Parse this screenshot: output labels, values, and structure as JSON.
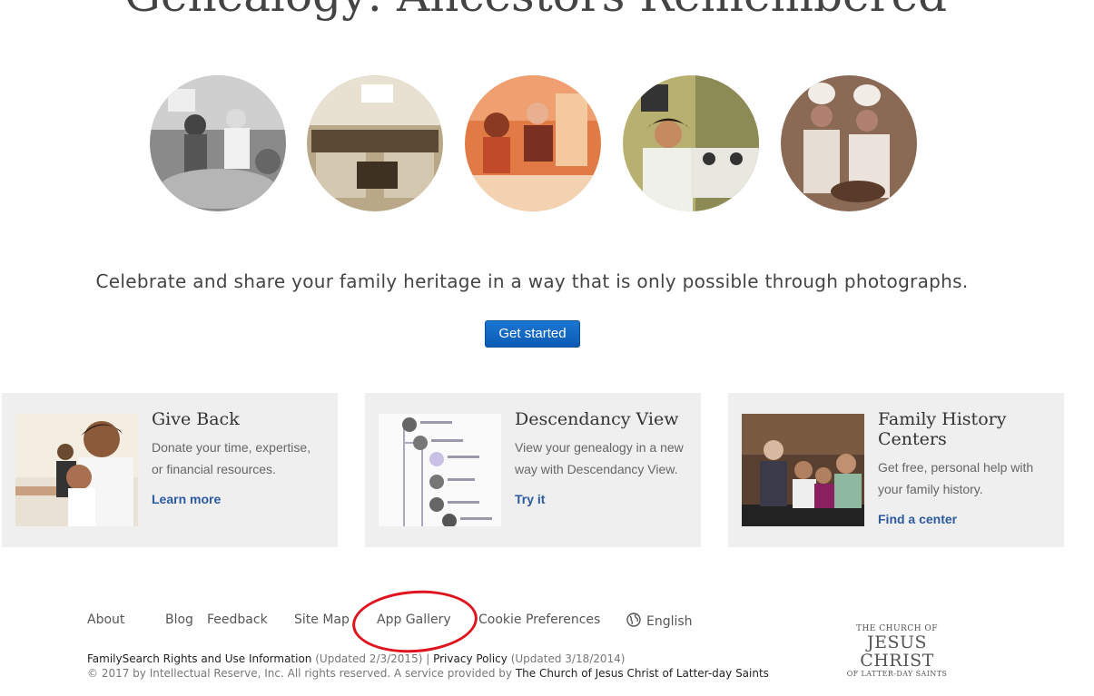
{
  "hero": {
    "title": "Genealogy: Ancestors Remembered",
    "tagline": "Celebrate and share your family heritage in a way that is only possible through photographs.",
    "cta_label": "Get started"
  },
  "cards": [
    {
      "title": "Give Back",
      "description": "Donate your time, expertise, or financial resources.",
      "link": "Learn more"
    },
    {
      "title": "Descendancy View",
      "description": "View your genealogy in a new way with Descendancy View.",
      "link": "Try it"
    },
    {
      "title": "Family History Centers",
      "description": "Get free, personal help with your family history.",
      "link": "Find a center"
    }
  ],
  "footer": {
    "nav": [
      "About",
      "Blog",
      "Feedback",
      "Site Map",
      "App Gallery",
      "Cookie Preferences",
      "English"
    ],
    "language_icon": "globe-icon",
    "rights_link": "FamilySearch Rights and Use Information",
    "rights_updated": "(Updated 2/3/2015)",
    "separator": "|",
    "privacy_link": "Privacy Policy",
    "privacy_updated": "(Updated 3/18/2014)",
    "copyright": "© 2017 by Intellectual Reserve, Inc. All rights reserved. A service provided by",
    "church_link": "The Church of Jesus Christ of Latter-day Saints"
  },
  "church_logo": {
    "line1": "THE CHURCH OF",
    "line2": "JESUS CHRIST",
    "line3": "OF LATTER-DAY SAINTS"
  },
  "annotation_color": "#e0141e",
  "accent_color": "#1a76d2"
}
